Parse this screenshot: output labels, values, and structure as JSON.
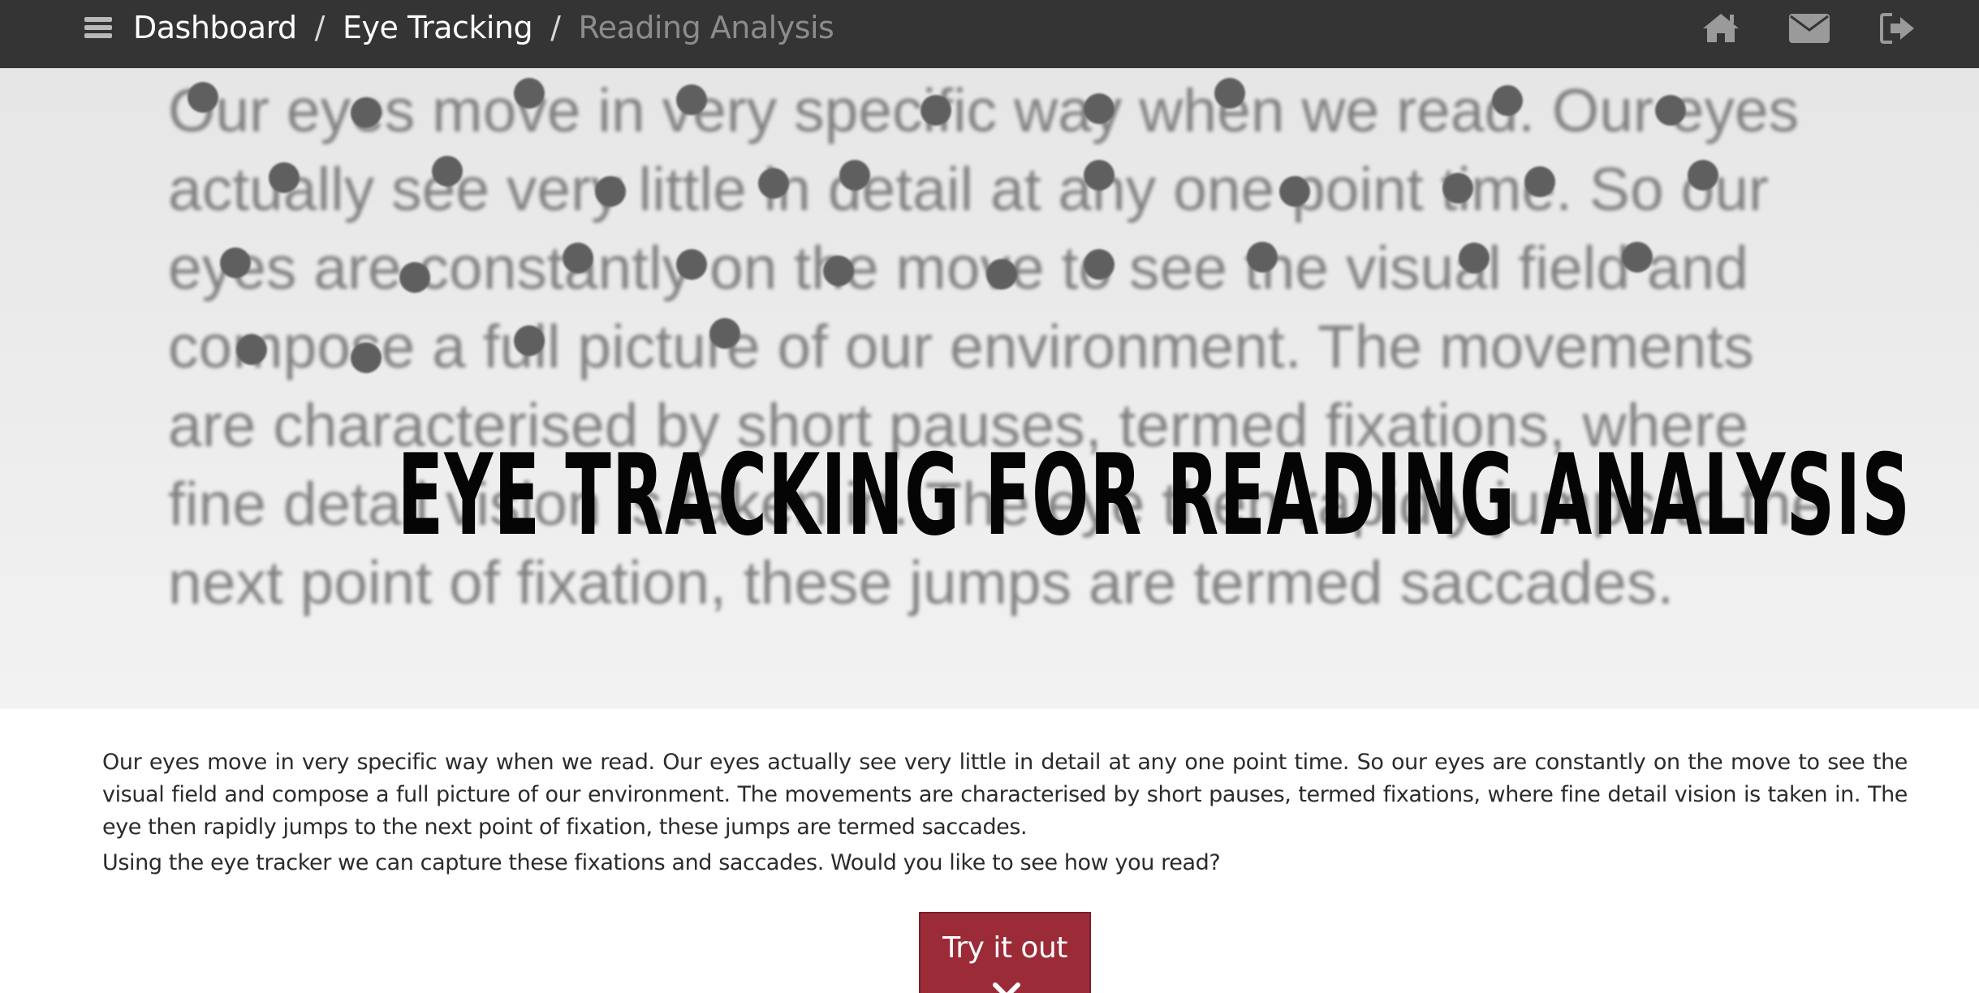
{
  "header": {
    "menu_icon": "hamburger-menu-icon",
    "breadcrumb": {
      "items": [
        "Dashboard",
        "Eye Tracking"
      ],
      "separator": "/",
      "current": "Reading Analysis"
    },
    "icons": [
      "home-icon",
      "mail-icon",
      "logout-icon"
    ],
    "background": "#343434"
  },
  "hero": {
    "background_text": "Our eyes move in very specific way when we read. Our eyes actually see very little in detail at any one point time. So our eyes are constantly on the move to see the visual field and compose a full picture of our environment. The movements are characterised by short pauses, termed fixations, where fine detail vision is taken in. The eye then rapidly jumps to the next point of fixation, these jumps are termed saccades.",
    "title": "EYE TRACKING FOR READING ANALYSIS"
  },
  "content": {
    "paragraph_1": "Our eyes move in very specific way when we read. Our eyes actually see very little in detail at any one point time. So our eyes are constantly on the move to see the visual field and compose a full picture of our environment. The movements are characterised by short pauses, termed fixations, where fine detail vision is taken in. The eye then rapidly jumps to the next point of fixation, these jumps are termed saccades.",
    "paragraph_2": "Using the eye tracker we can capture these fixations and saccades. Would you like to see how you read?"
  },
  "cta": {
    "label": "Try it out",
    "icon": "close-icon",
    "color": "#9c2b38"
  }
}
